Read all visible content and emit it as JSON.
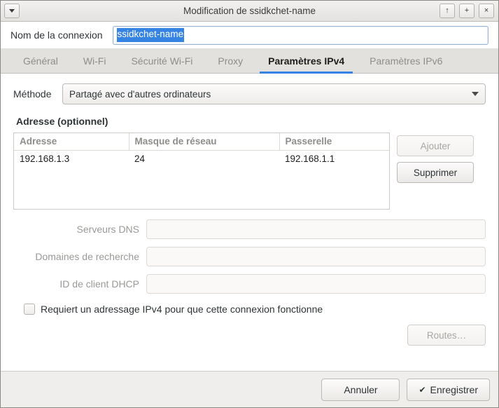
{
  "window": {
    "title": "Modification de ssidkchet-name",
    "menu_icon": "chevron-down-icon",
    "shade_label": "↑",
    "maximize_label": "+",
    "close_label": "×"
  },
  "connection_name": {
    "label": "Nom de la connexion",
    "value": "ssidkchet-name",
    "selected": true,
    "selection_color": "#3584e4"
  },
  "tabs": [
    {
      "label": "Général",
      "active": false
    },
    {
      "label": "Wi-Fi",
      "active": false
    },
    {
      "label": "Sécurité Wi-Fi",
      "active": false
    },
    {
      "label": "Proxy",
      "active": false
    },
    {
      "label": "Paramètres IPv4",
      "active": true
    },
    {
      "label": "Paramètres IPv6",
      "active": false
    }
  ],
  "active_tab_underline_color": "#3584e4",
  "method": {
    "label": "Méthode",
    "value": "Partagé avec d'autres ordinateurs",
    "arrow_icon": "chevron-down-icon"
  },
  "address_section": {
    "title": "Adresse (optionnel)",
    "columns": [
      "Adresse",
      "Masque de réseau",
      "Passerelle"
    ],
    "rows": [
      {
        "address": "192.168.1.3",
        "netmask": "24",
        "gateway": "192.168.1.1"
      }
    ],
    "add_button": {
      "label": "Ajouter",
      "disabled": true
    },
    "delete_button": {
      "label": "Supprimer",
      "disabled": false
    }
  },
  "fields": [
    {
      "label": "Serveurs DNS",
      "value": "",
      "disabled": true
    },
    {
      "label": "Domaines de recherche",
      "value": "",
      "disabled": true
    },
    {
      "label": "ID de client DHCP",
      "value": "",
      "disabled": true
    }
  ],
  "require_ipv4": {
    "label": "Requiert un adressage IPv4 pour que cette connexion fonctionne",
    "checked": false
  },
  "routes_button": {
    "label": "Routes…",
    "disabled": true
  },
  "actions": {
    "cancel_label": "Annuler",
    "save_label": "Enregistrer",
    "save_icon_glyph": "✔"
  }
}
